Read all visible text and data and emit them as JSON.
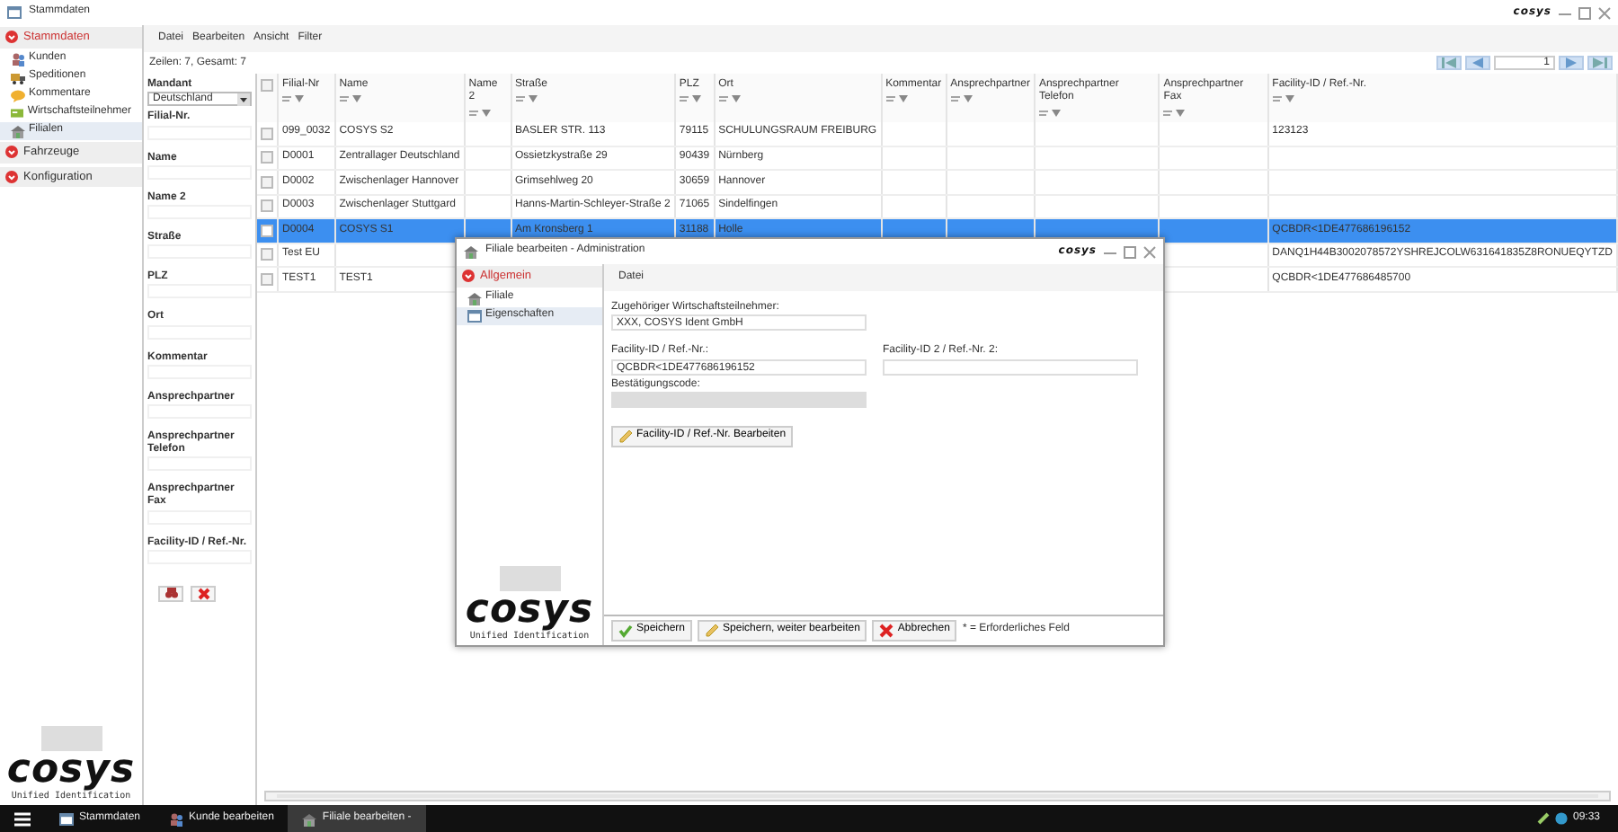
{
  "window": {
    "title": "Stammdaten",
    "logo": "cosys"
  },
  "nav": {
    "sections": [
      {
        "label": "Stammdaten",
        "selected": true,
        "items": [
          {
            "label": "Kunden",
            "selected": false
          },
          {
            "label": "Speditionen",
            "selected": false
          },
          {
            "label": "Kommentare",
            "selected": false
          },
          {
            "label": "Wirtschaftsteilnehmer",
            "selected": false
          },
          {
            "label": "Filialen",
            "selected": true
          }
        ]
      },
      {
        "label": "Fahrzeuge",
        "selected": false
      },
      {
        "label": "Konfiguration",
        "selected": false
      }
    ]
  },
  "brand": {
    "logo": "cosys",
    "tagline": "Unified Identification"
  },
  "menu": [
    "Datei",
    "Bearbeiten",
    "Ansicht",
    "Filter"
  ],
  "row_count": "Zeilen: 7, Gesamt: 7",
  "pager": {
    "page": "1"
  },
  "filters": {
    "mandant": {
      "label": "Mandant",
      "value": "Deutschland"
    },
    "fields": [
      "Filial-Nr.",
      "Name",
      "Name 2",
      "Straße",
      "PLZ",
      "Ort",
      "Kommentar",
      "Ansprechpartner",
      "Ansprechpartner Telefon",
      "Ansprechpartner Fax",
      "Facility-ID / Ref.-Nr."
    ]
  },
  "table": {
    "select_all_checked": false,
    "columns": [
      "Filial-Nr",
      "Name",
      "Name 2",
      "Straße",
      "PLZ",
      "Ort",
      "Kommentar",
      "Ansprechpartner",
      "Ansprechpartner Telefon",
      "Ansprechpartner Fax",
      "Facility-ID / Ref.-Nr."
    ],
    "rows": [
      {
        "selected": false,
        "checked": false,
        "cells": [
          "099_0032",
          "COSYS S2",
          null,
          "BASLER STR. 113",
          "79115",
          "SCHULUNGSRAUM FREIBURG",
          null,
          null,
          null,
          null,
          "123123"
        ]
      },
      {
        "selected": false,
        "checked": false,
        "cells": [
          "D0001",
          "Zentrallager Deutschland",
          null,
          "Ossietzkystraße 29",
          "90439",
          "Nürnberg",
          null,
          null,
          null,
          null,
          null
        ]
      },
      {
        "selected": false,
        "checked": false,
        "cells": [
          "D0002",
          "Zwischenlager Hannover",
          null,
          "Grimsehlweg 20",
          "30659",
          "Hannover",
          null,
          null,
          null,
          null,
          null
        ]
      },
      {
        "selected": false,
        "checked": false,
        "cells": [
          "D0003",
          "Zwischenlager Stuttgard",
          null,
          "Hanns-Martin-Schleyer-Straße 2",
          "71065",
          "Sindelfingen",
          null,
          null,
          null,
          null,
          null
        ]
      },
      {
        "selected": true,
        "checked": false,
        "cells": [
          "D0004",
          "COSYS S1",
          null,
          "Am Kronsberg 1",
          "31188",
          "Holle",
          null,
          null,
          null,
          null,
          "QCBDR<1DE477686196152"
        ]
      },
      {
        "selected": false,
        "checked": false,
        "cells": [
          "Test EU",
          null,
          null,
          null,
          null,
          null,
          null,
          null,
          null,
          null,
          "DANQ1H44B3002078572YSHREJCOLW631641835Z8RONUEQYTZD"
        ]
      },
      {
        "selected": false,
        "checked": false,
        "cells": [
          "TEST1",
          "TEST1",
          null,
          null,
          null,
          null,
          null,
          null,
          null,
          null,
          "QCBDR<1DE477686485700"
        ]
      }
    ]
  },
  "dialog": {
    "title": "Filiale bearbeiten - Administration",
    "logo": "cosys",
    "nav": {
      "section": "Allgemein",
      "items": [
        {
          "label": "Filiale",
          "selected": false
        },
        {
          "label": "Eigenschaften",
          "selected": true
        }
      ]
    },
    "brand": {
      "logo": "cosys",
      "tagline": "Unified Identification"
    },
    "menu": [
      "Datei"
    ],
    "fields": [
      {
        "label": "Zugehöriger Wirtschaftsteilnehmer:",
        "value": "XXX, COSYS Ident GmbH",
        "disabled": false
      },
      {
        "label": "Facility-ID / Ref.-Nr.:",
        "value": "QCBDR<1DE477686196152",
        "disabled": false
      },
      {
        "label": "Facility-ID 2 / Ref.-Nr. 2:",
        "disabled": false
      },
      {
        "label": "Bestätigungscode:",
        "disabled": true
      }
    ],
    "edit_button": "Facility-ID / Ref.-Nr. Bearbeiten",
    "footer": {
      "buttons": [
        "Speichern",
        "Speichern, weiter bearbeiten",
        "Abbrechen"
      ],
      "note": "* = Erforderliches Feld"
    }
  },
  "taskbar": {
    "items": [
      {
        "label": "Stammdaten",
        "selected": false
      },
      {
        "label": "Kunde bearbeiten",
        "selected": false
      },
      {
        "label": "Filiale bearbeiten -",
        "selected": true
      }
    ],
    "clock": "09:33"
  }
}
